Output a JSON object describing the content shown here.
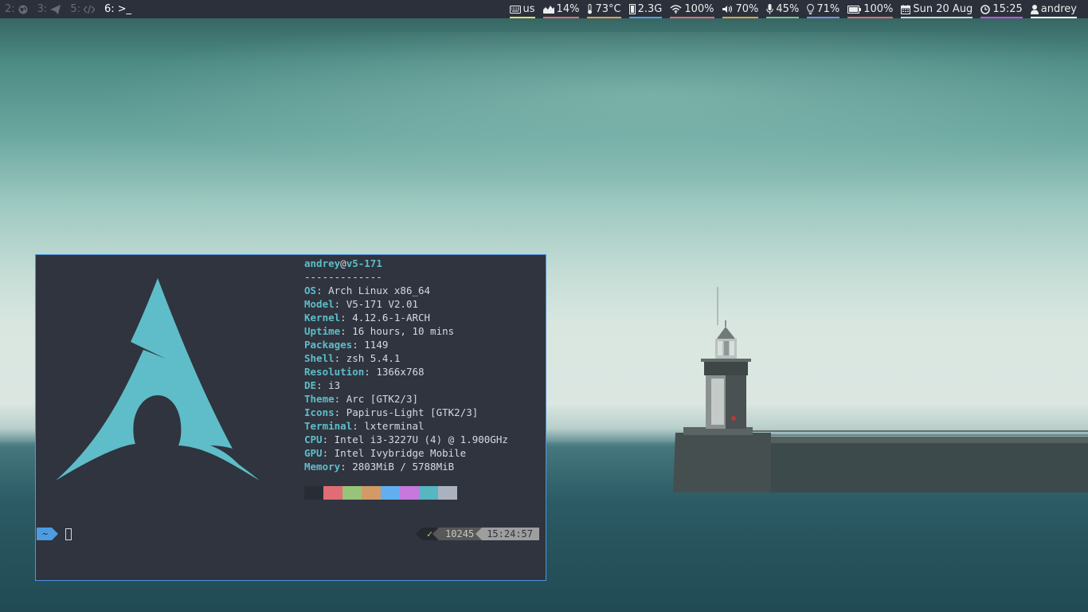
{
  "workspaces": [
    {
      "num": "2:",
      "icon": "globe-icon",
      "active": false
    },
    {
      "num": "3:",
      "icon": "send-icon",
      "active": false
    },
    {
      "num": "5:",
      "icon": "code-icon",
      "active": false
    },
    {
      "num": "6:",
      "icon": "terminal-icon",
      "label": ">_",
      "active": true
    }
  ],
  "status": {
    "keyboard": {
      "text": "us",
      "icon": "keyboard-icon",
      "color": "#e5d96c"
    },
    "cpu": {
      "text": "14%",
      "icon": "chart-icon",
      "color": "#e06c75"
    },
    "temp": {
      "text": "73°C",
      "icon": "thermometer-icon",
      "color": "#e59a5c"
    },
    "memory": {
      "text": "2.3G",
      "icon": "memory-icon",
      "color": "#5b9be0"
    },
    "wifi": {
      "text": "100%",
      "icon": "wifi-icon",
      "color": "#e06c75"
    },
    "volume": {
      "text": "70%",
      "icon": "volume-icon",
      "color": "#e5a04c"
    },
    "mic": {
      "text": "45%",
      "icon": "microphone-icon",
      "color": "#7fc27f"
    },
    "brightness": {
      "text": "71%",
      "icon": "lightbulb-icon",
      "color": "#7a8fe0"
    },
    "battery": {
      "text": "100%",
      "icon": "battery-icon",
      "color": "#e06c75"
    },
    "date": {
      "text": "Sun 20 Aug",
      "icon": "calendar-icon",
      "color": "#d0d0d0"
    },
    "time": {
      "text": "15:25",
      "icon": "clock-icon",
      "color": "#c94ee0"
    },
    "user": {
      "text": "andrey",
      "icon": "user-icon",
      "color": "#ffffff"
    }
  },
  "terminal": {
    "user": "andrey",
    "at": "@",
    "host": "v5-171",
    "separator": "-------------",
    "info": [
      {
        "key": "OS",
        "value": "Arch Linux x86_64"
      },
      {
        "key": "Model",
        "value": "V5-171 V2.01"
      },
      {
        "key": "Kernel",
        "value": "4.12.6-1-ARCH"
      },
      {
        "key": "Uptime",
        "value": "16 hours, 10 mins"
      },
      {
        "key": "Packages",
        "value": "1149"
      },
      {
        "key": "Shell",
        "value": "zsh 5.4.1"
      },
      {
        "key": "Resolution",
        "value": "1366x768"
      },
      {
        "key": "DE",
        "value": "i3"
      },
      {
        "key": "Theme",
        "value": "Arc [GTK2/3]"
      },
      {
        "key": "Icons",
        "value": "Papirus-Light [GTK2/3]"
      },
      {
        "key": "Terminal",
        "value": "lxterminal"
      },
      {
        "key": "CPU",
        "value": "Intel i3-3227U (4) @ 1.900GHz"
      },
      {
        "key": "GPU",
        "value": "Intel Ivybridge Mobile"
      },
      {
        "key": "Memory",
        "value": "2803MiB / 5788MiB"
      }
    ],
    "palette": [
      "#282c34",
      "#e06c75",
      "#98c379",
      "#d19a66",
      "#61afef",
      "#c678dd",
      "#56b6c2",
      "#abb2bf"
    ],
    "prompt_dir": "~",
    "rprompt": {
      "status": "✓",
      "history": "10245",
      "time": "15:24:57"
    }
  },
  "colors": {
    "arch_blue": "#5ebdc8",
    "terminal_bg": "#2f343f",
    "bar_bg": "#2b303b"
  }
}
